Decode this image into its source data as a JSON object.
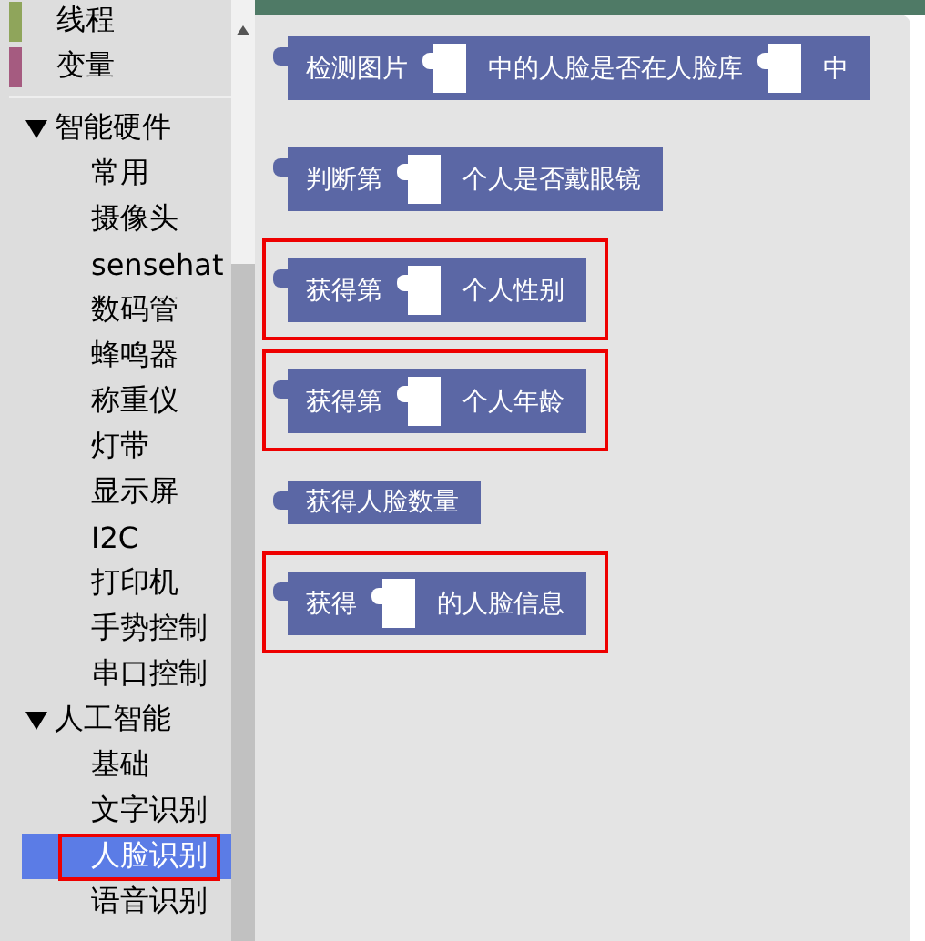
{
  "sidebar": {
    "categories": [
      {
        "label": "线程",
        "color": "#8fa55b"
      },
      {
        "label": "变量",
        "color": "#a55b80"
      }
    ],
    "groups": [
      {
        "label": "智能硬件",
        "expanded": true,
        "children": [
          {
            "label": "常用",
            "selected": false,
            "highlighted": false
          },
          {
            "label": "摄像头",
            "selected": false,
            "highlighted": false
          },
          {
            "label": "sensehat",
            "selected": false,
            "highlighted": false
          },
          {
            "label": "数码管",
            "selected": false,
            "highlighted": false
          },
          {
            "label": "蜂鸣器",
            "selected": false,
            "highlighted": false
          },
          {
            "label": "称重仪",
            "selected": false,
            "highlighted": false
          },
          {
            "label": "灯带",
            "selected": false,
            "highlighted": false
          },
          {
            "label": "显示屏",
            "selected": false,
            "highlighted": false
          },
          {
            "label": "I2C",
            "selected": false,
            "highlighted": false
          },
          {
            "label": "打印机",
            "selected": false,
            "highlighted": false
          },
          {
            "label": "手势控制",
            "selected": false,
            "highlighted": false
          },
          {
            "label": "串口控制",
            "selected": false,
            "highlighted": false
          }
        ]
      },
      {
        "label": "人工智能",
        "expanded": true,
        "children": [
          {
            "label": "基础",
            "selected": false,
            "highlighted": false
          },
          {
            "label": "文字识别",
            "selected": false,
            "highlighted": false
          },
          {
            "label": "人脸识别",
            "selected": true,
            "highlighted": true
          },
          {
            "label": "语音识别",
            "selected": false,
            "highlighted": false
          }
        ]
      }
    ]
  },
  "blocks": [
    {
      "highlighted": false,
      "parts": [
        {
          "kind": "text",
          "text": "检测图片"
        },
        {
          "kind": "slot"
        },
        {
          "kind": "text",
          "text": "中的人脸是否在人脸库"
        },
        {
          "kind": "slot"
        },
        {
          "kind": "text",
          "text": "中"
        }
      ]
    },
    {
      "highlighted": false,
      "parts": [
        {
          "kind": "text",
          "text": "判断第"
        },
        {
          "kind": "slot"
        },
        {
          "kind": "text",
          "text": "个人是否戴眼镜"
        }
      ]
    },
    {
      "highlighted": true,
      "parts": [
        {
          "kind": "text",
          "text": "获得第"
        },
        {
          "kind": "slot"
        },
        {
          "kind": "text",
          "text": "个人性别"
        }
      ]
    },
    {
      "highlighted": true,
      "parts": [
        {
          "kind": "text",
          "text": "获得第"
        },
        {
          "kind": "slot"
        },
        {
          "kind": "text",
          "text": "个人年龄"
        }
      ]
    },
    {
      "highlighted": false,
      "parts": [
        {
          "kind": "text",
          "text": "获得人脸数量"
        }
      ]
    },
    {
      "highlighted": true,
      "parts": [
        {
          "kind": "text",
          "text": "获得"
        },
        {
          "kind": "slot"
        },
        {
          "kind": "text",
          "text": "的人脸信息"
        }
      ]
    }
  ]
}
